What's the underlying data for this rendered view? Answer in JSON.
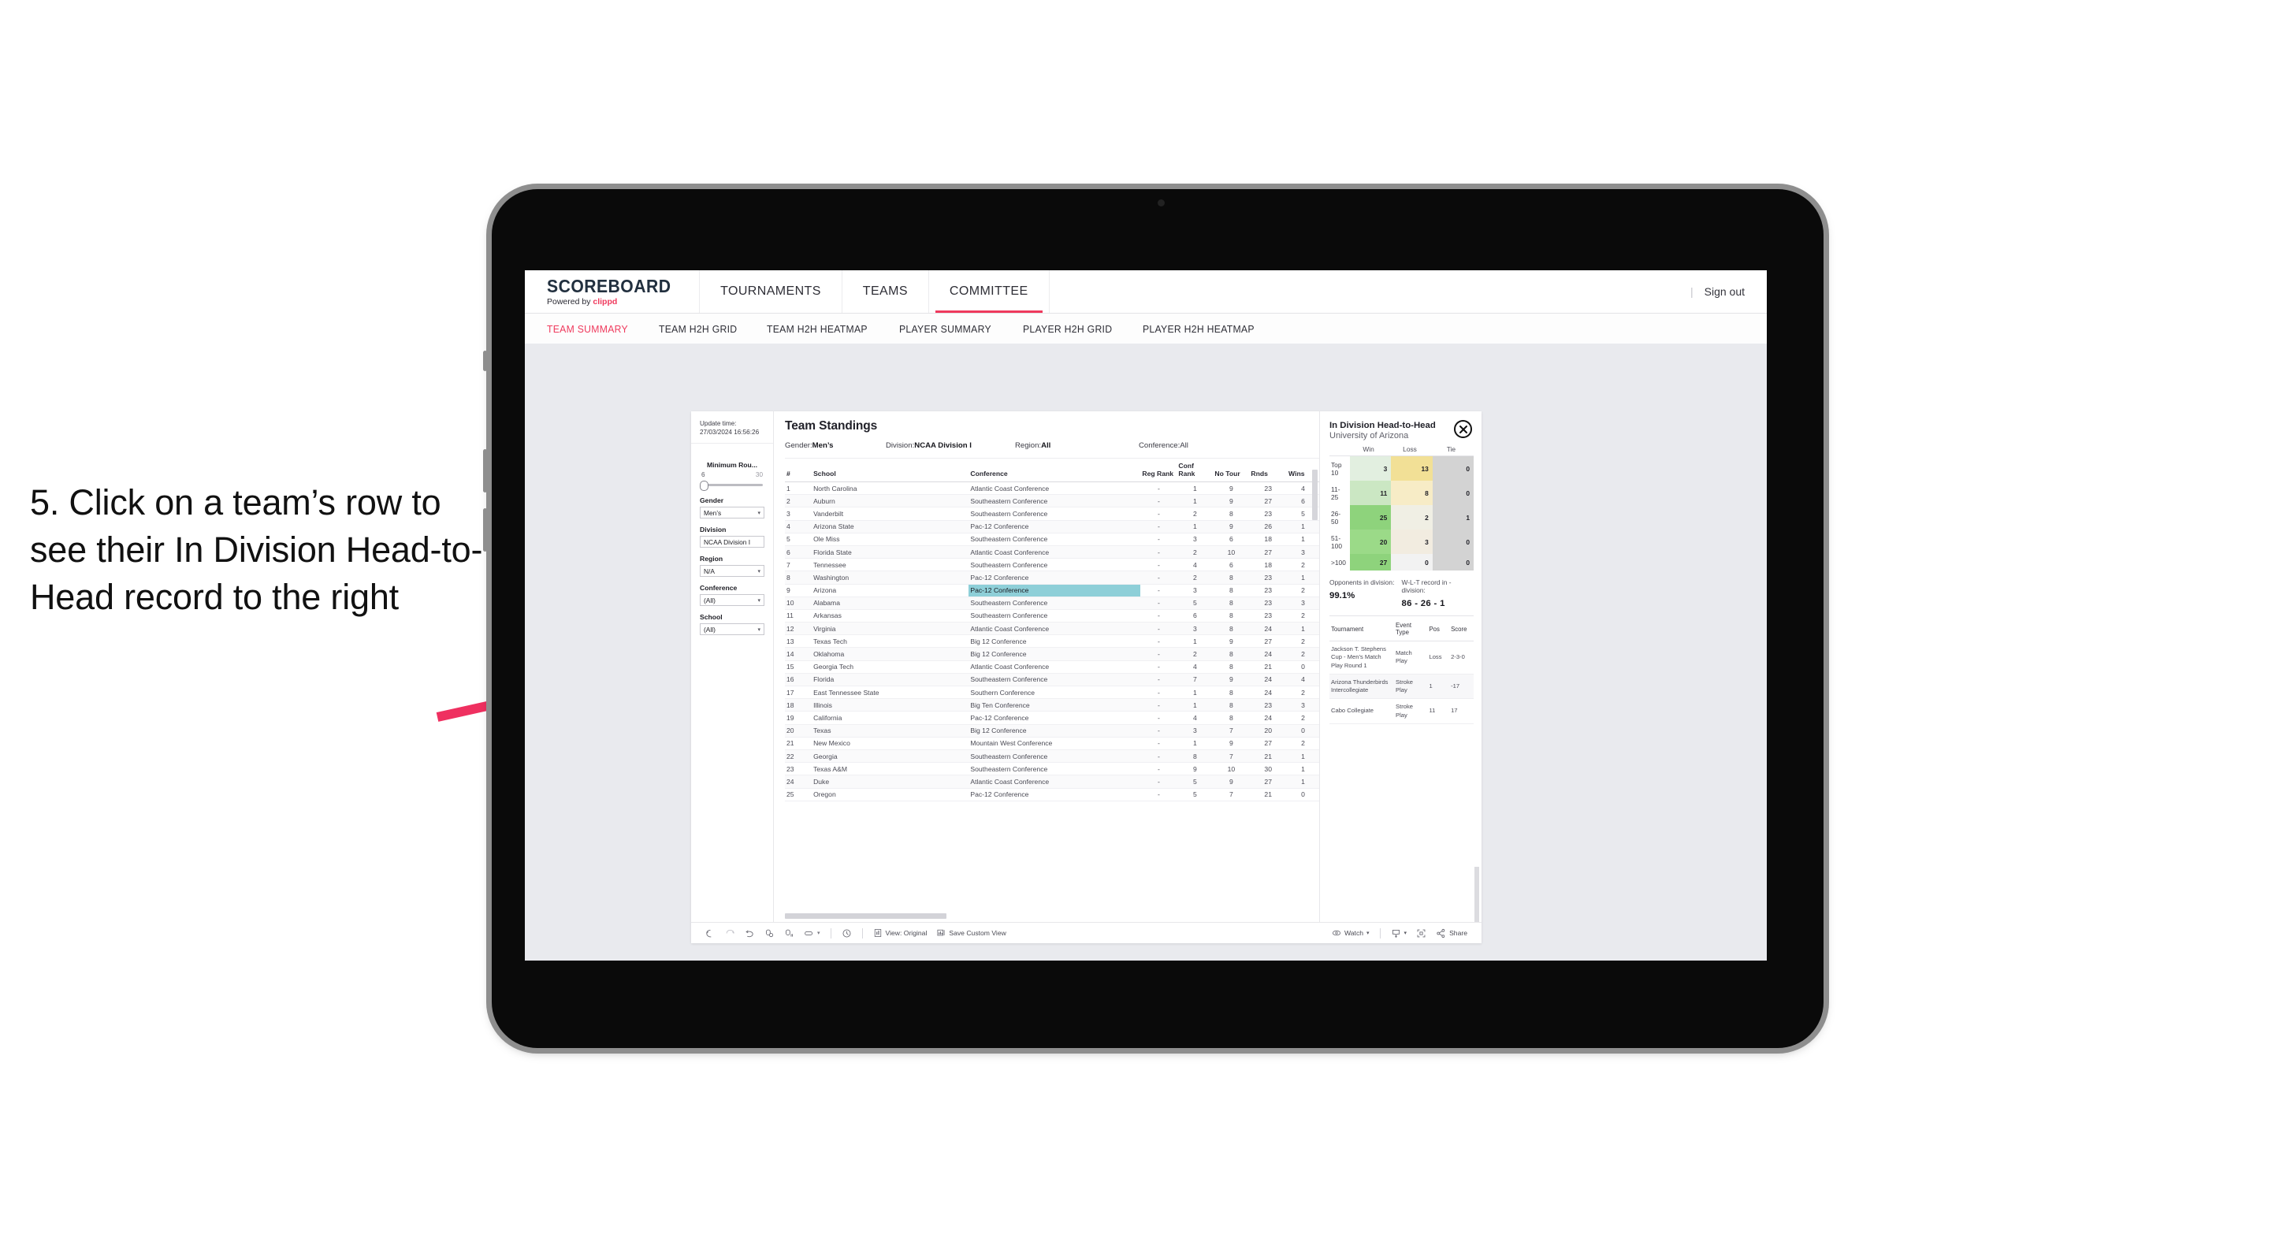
{
  "annotation": {
    "text": "5. Click on a team’s row to see their In Division Head-to-Head record to the right",
    "arrow_color": "#ef3060"
  },
  "topnav": {
    "brand_name": "SCOREBOARD",
    "brand_sub_prefix": "Powered by ",
    "brand_sub_accent": "clippd",
    "items": [
      {
        "label": "TOURNAMENTS",
        "active": false
      },
      {
        "label": "TEAMS",
        "active": false
      },
      {
        "label": "COMMITTEE",
        "active": true
      }
    ],
    "separator": "|",
    "sign_out": "Sign out",
    "accent_color": "#ef3a5d"
  },
  "subtabs": [
    {
      "label": "TEAM SUMMARY",
      "active": true
    },
    {
      "label": "TEAM H2H GRID",
      "active": false
    },
    {
      "label": "TEAM H2H HEATMAP",
      "active": false
    },
    {
      "label": "PLAYER SUMMARY",
      "active": false
    },
    {
      "label": "PLAYER H2H GRID",
      "active": false
    },
    {
      "label": "PLAYER H2H HEATMAP",
      "active": false
    }
  ],
  "filters": {
    "update_time_label": "Update time:",
    "update_time_value": "27/03/2024 16:56:26",
    "min_rounds": {
      "label": "Minimum Rou...",
      "min": "6",
      "max": "30"
    },
    "gender": {
      "label": "Gender",
      "value": "Men’s"
    },
    "division": {
      "label": "Division",
      "value": "NCAA Division I"
    },
    "region": {
      "label": "Region",
      "value": "N/A"
    },
    "conference": {
      "label": "Conference",
      "value": "(All)"
    },
    "school": {
      "label": "School",
      "value": "(All)"
    }
  },
  "standings": {
    "title": "Team Standings",
    "meta": [
      {
        "label": "Gender: ",
        "value": "Men’s"
      },
      {
        "label": "Division: ",
        "value": "NCAA Division I"
      },
      {
        "label": "Region: ",
        "value": "All"
      },
      {
        "label": "Conference: ",
        "value": "All"
      }
    ],
    "columns": [
      "#",
      "School",
      "Conference",
      "Reg Rank",
      "Conf Rank",
      "No Tour",
      "Rnds",
      "Wins"
    ],
    "rows": [
      [
        "1",
        "North Carolina",
        "Atlantic Coast Conference",
        "-",
        "1",
        "9",
        "23",
        "4"
      ],
      [
        "2",
        "Auburn",
        "Southeastern Conference",
        "-",
        "1",
        "9",
        "27",
        "6"
      ],
      [
        "3",
        "Vanderbilt",
        "Southeastern Conference",
        "-",
        "2",
        "8",
        "23",
        "5"
      ],
      [
        "4",
        "Arizona State",
        "Pac-12 Conference",
        "-",
        "1",
        "9",
        "26",
        "1"
      ],
      [
        "5",
        "Ole Miss",
        "Southeastern Conference",
        "-",
        "3",
        "6",
        "18",
        "1"
      ],
      [
        "6",
        "Florida State",
        "Atlantic Coast Conference",
        "-",
        "2",
        "10",
        "27",
        "3"
      ],
      [
        "7",
        "Tennessee",
        "Southeastern Conference",
        "-",
        "4",
        "6",
        "18",
        "2"
      ],
      [
        "8",
        "Washington",
        "Pac-12 Conference",
        "-",
        "2",
        "8",
        "23",
        "1"
      ],
      [
        "9",
        "Arizona",
        "Pac-12 Conference",
        "-",
        "3",
        "8",
        "23",
        "2"
      ],
      [
        "10",
        "Alabama",
        "Southeastern Conference",
        "-",
        "5",
        "8",
        "23",
        "3"
      ],
      [
        "11",
        "Arkansas",
        "Southeastern Conference",
        "-",
        "6",
        "8",
        "23",
        "2"
      ],
      [
        "12",
        "Virginia",
        "Atlantic Coast Conference",
        "-",
        "3",
        "8",
        "24",
        "1"
      ],
      [
        "13",
        "Texas Tech",
        "Big 12 Conference",
        "-",
        "1",
        "9",
        "27",
        "2"
      ],
      [
        "14",
        "Oklahoma",
        "Big 12 Conference",
        "-",
        "2",
        "8",
        "24",
        "2"
      ],
      [
        "15",
        "Georgia Tech",
        "Atlantic Coast Conference",
        "-",
        "4",
        "8",
        "21",
        "0"
      ],
      [
        "16",
        "Florida",
        "Southeastern Conference",
        "-",
        "7",
        "9",
        "24",
        "4"
      ],
      [
        "17",
        "East Tennessee State",
        "Southern Conference",
        "-",
        "1",
        "8",
        "24",
        "2"
      ],
      [
        "18",
        "Illinois",
        "Big Ten Conference",
        "-",
        "1",
        "8",
        "23",
        "3"
      ],
      [
        "19",
        "California",
        "Pac-12 Conference",
        "-",
        "4",
        "8",
        "24",
        "2"
      ],
      [
        "20",
        "Texas",
        "Big 12 Conference",
        "-",
        "3",
        "7",
        "20",
        "0"
      ],
      [
        "21",
        "New Mexico",
        "Mountain West Conference",
        "-",
        "1",
        "9",
        "27",
        "2"
      ],
      [
        "22",
        "Georgia",
        "Southeastern Conference",
        "-",
        "8",
        "7",
        "21",
        "1"
      ],
      [
        "23",
        "Texas A&M",
        "Southeastern Conference",
        "-",
        "9",
        "10",
        "30",
        "1"
      ],
      [
        "24",
        "Duke",
        "Atlantic Coast Conference",
        "-",
        "5",
        "9",
        "27",
        "1"
      ],
      [
        "25",
        "Oregon",
        "Pac-12 Conference",
        "-",
        "5",
        "7",
        "21",
        "0"
      ]
    ],
    "selected_row_index": 8,
    "selected_highlight_color": "#8ecfd8"
  },
  "detail": {
    "title": "In Division Head-to-Head",
    "subtitle": "University of Arizona",
    "close_icon": "close-icon",
    "h2h": {
      "columns": [
        "",
        "Win",
        "Loss",
        "Tie"
      ],
      "rows": [
        {
          "label": "Top 10",
          "win": "3",
          "loss": "13",
          "tie": "0",
          "win_color": "#e2efe0",
          "loss_color": "#f2e096",
          "tie_color": "#d3d3d3"
        },
        {
          "label": "11-25",
          "win": "11",
          "loss": "8",
          "tie": "0",
          "win_color": "#cbe7c3",
          "loss_color": "#f7ecc6",
          "tie_color": "#d3d3d3"
        },
        {
          "label": "26-50",
          "win": "25",
          "loss": "2",
          "tie": "1",
          "win_color": "#8ed37c",
          "loss_color": "#f0efe4",
          "tie_color": "#d3d3d3"
        },
        {
          "label": "51-100",
          "win": "20",
          "loss": "3",
          "tie": "0",
          "win_color": "#9bda88",
          "loss_color": "#f2ece0",
          "tie_color": "#d3d3d3"
        },
        {
          "label": ">100",
          "win": "27",
          "loss": "0",
          "tie": "0",
          "win_color": "#8ed37c",
          "loss_color": "#f2f2f2",
          "tie_color": "#d3d3d3"
        }
      ]
    },
    "stats": [
      {
        "label": "Opponents in division:",
        "value": "99.1%"
      },
      {
        "label": "W-L-T record in -division:",
        "value": "86 - 26 - 1"
      }
    ],
    "tournaments": {
      "columns": [
        "Tournament",
        "Event Type",
        "Pos",
        "Score"
      ],
      "rows": [
        [
          "Jackson T. Stephens Cup - Men’s Match Play Round 1",
          "Match Play",
          "Loss",
          "2-3-0"
        ],
        [
          "Arizona Thunderbirds Intercollegiate",
          "Stroke Play",
          "1",
          "-17"
        ],
        [
          "Cabo Collegiate",
          "Stroke Play",
          "11",
          "17"
        ]
      ]
    }
  },
  "toolbar": {
    "undo": "undo-icon",
    "redo": "redo-icon",
    "revert": "revert-icon",
    "refresh": "refresh-data-icon",
    "pause": "pause-updates-icon",
    "shape": "shape-icon",
    "shape_caret": "▾",
    "clock": "clock-icon",
    "view_label": "View: Original",
    "save_custom_view_label": "Save Custom View",
    "watch_label": "Watch",
    "watch_caret": "▾",
    "download_caret": "▾",
    "fullscreen": "fullscreen-icon",
    "share_label": "Share"
  }
}
